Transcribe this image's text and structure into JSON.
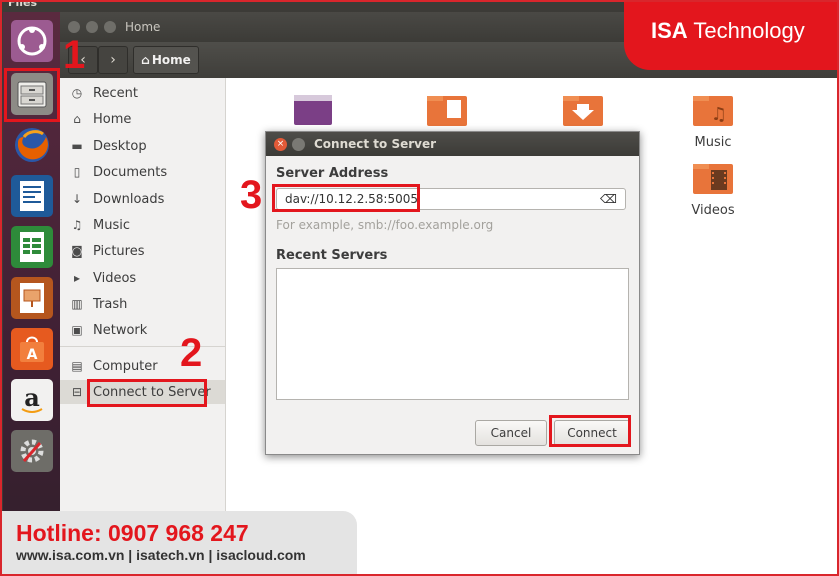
{
  "topbar": {
    "title": "Files"
  },
  "window": {
    "title": "Home",
    "breadcrumb": "Home"
  },
  "sidebar": {
    "items": [
      {
        "label": "Recent",
        "icon": "clock-icon"
      },
      {
        "label": "Home",
        "icon": "home-icon"
      },
      {
        "label": "Desktop",
        "icon": "folder-icon"
      },
      {
        "label": "Documents",
        "icon": "document-icon"
      },
      {
        "label": "Downloads",
        "icon": "download-icon"
      },
      {
        "label": "Music",
        "icon": "music-icon"
      },
      {
        "label": "Pictures",
        "icon": "camera-icon"
      },
      {
        "label": "Videos",
        "icon": "video-icon"
      },
      {
        "label": "Trash",
        "icon": "trash-icon"
      },
      {
        "label": "Network",
        "icon": "network-icon"
      },
      {
        "label": "Computer",
        "icon": "computer-icon"
      },
      {
        "label": "Connect to Server",
        "icon": "server-icon"
      }
    ]
  },
  "content": {
    "folders": [
      {
        "label": "Music"
      },
      {
        "label": "Videos"
      }
    ]
  },
  "dialog": {
    "title": "Connect to Server",
    "server_address_label": "Server Address",
    "server_address_value": "dav://10.12.2.58:5005",
    "hint": "For example, smb://foo.example.org",
    "recent_label": "Recent Servers",
    "cancel_label": "Cancel",
    "connect_label": "Connect"
  },
  "annotations": {
    "step1": "1",
    "step2": "2",
    "step3": "3"
  },
  "branding": {
    "logo_bold": "ISA",
    "logo_rest": "Technology",
    "hotline": "Hotline: 0907 968 247",
    "websites": "www.isa.com.vn | isatech.vn | isacloud.com"
  },
  "colors": {
    "accent_red": "#e3161d",
    "launcher": "#4a2438",
    "titlebar": "#3c3b37",
    "ubuntu_orange": "#e25a38"
  }
}
